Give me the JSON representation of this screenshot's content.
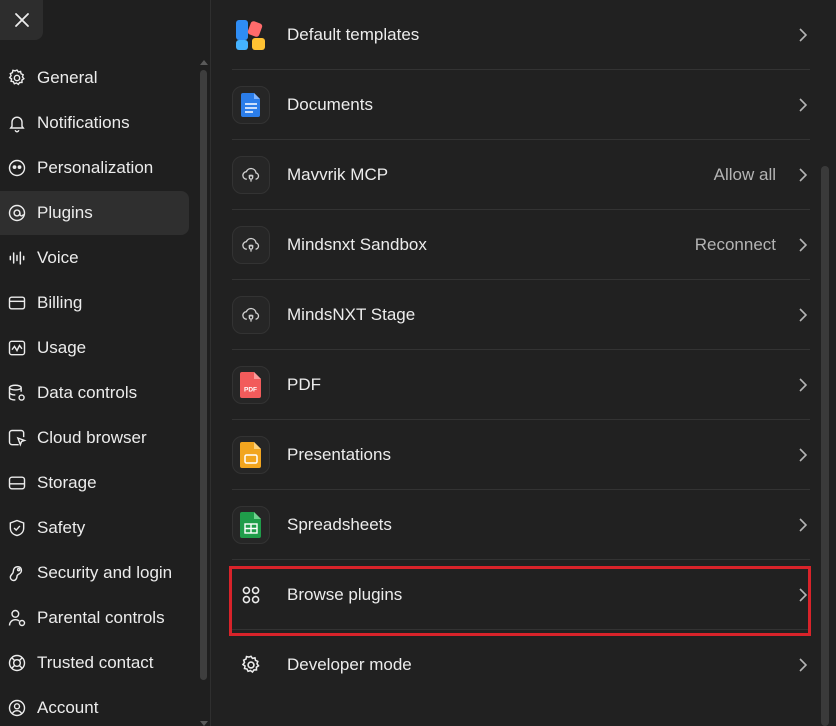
{
  "sidebar": {
    "items": [
      {
        "label": "General",
        "icon": "gear-icon"
      },
      {
        "label": "Notifications",
        "icon": "bell-icon"
      },
      {
        "label": "Personalization",
        "icon": "personalization-icon"
      },
      {
        "label": "Plugins",
        "icon": "plugins-icon",
        "active": true
      },
      {
        "label": "Voice",
        "icon": "waveform-icon"
      },
      {
        "label": "Billing",
        "icon": "card-icon"
      },
      {
        "label": "Usage",
        "icon": "chart-icon"
      },
      {
        "label": "Data controls",
        "icon": "database-icon"
      },
      {
        "label": "Cloud browser",
        "icon": "cloud-browser-icon"
      },
      {
        "label": "Storage",
        "icon": "storage-icon"
      },
      {
        "label": "Safety",
        "icon": "shield-icon"
      },
      {
        "label": "Security and login",
        "icon": "key-icon"
      },
      {
        "label": "Parental controls",
        "icon": "parental-icon"
      },
      {
        "label": "Trusted contact",
        "icon": "lifebuoy-icon"
      },
      {
        "label": "Account",
        "icon": "account-icon"
      }
    ]
  },
  "plugins": [
    {
      "label": "Default templates",
      "status": "",
      "icon": "templates-icon"
    },
    {
      "label": "Documents",
      "status": "",
      "icon": "documents-icon"
    },
    {
      "label": "Mavvrik MCP",
      "status": "Allow all",
      "icon": "cloud-plug-icon"
    },
    {
      "label": "Mindsnxt Sandbox",
      "status": "Reconnect",
      "icon": "cloud-plug-icon"
    },
    {
      "label": "MindsNXT Stage",
      "status": "",
      "icon": "cloud-plug-icon"
    },
    {
      "label": "PDF",
      "status": "",
      "icon": "pdf-icon",
      "badge": "PDF"
    },
    {
      "label": "Presentations",
      "status": "",
      "icon": "presentations-icon"
    },
    {
      "label": "Spreadsheets",
      "status": "",
      "icon": "spreadsheets-icon"
    },
    {
      "label": "Browse plugins",
      "status": "",
      "icon": "grid-icon"
    },
    {
      "label": "Developer mode",
      "status": "",
      "icon": "gear-icon"
    }
  ],
  "colors": {
    "background": "#212121",
    "highlight": "#d8232a",
    "text": "#ececec",
    "muted": "#b4b4b4"
  }
}
